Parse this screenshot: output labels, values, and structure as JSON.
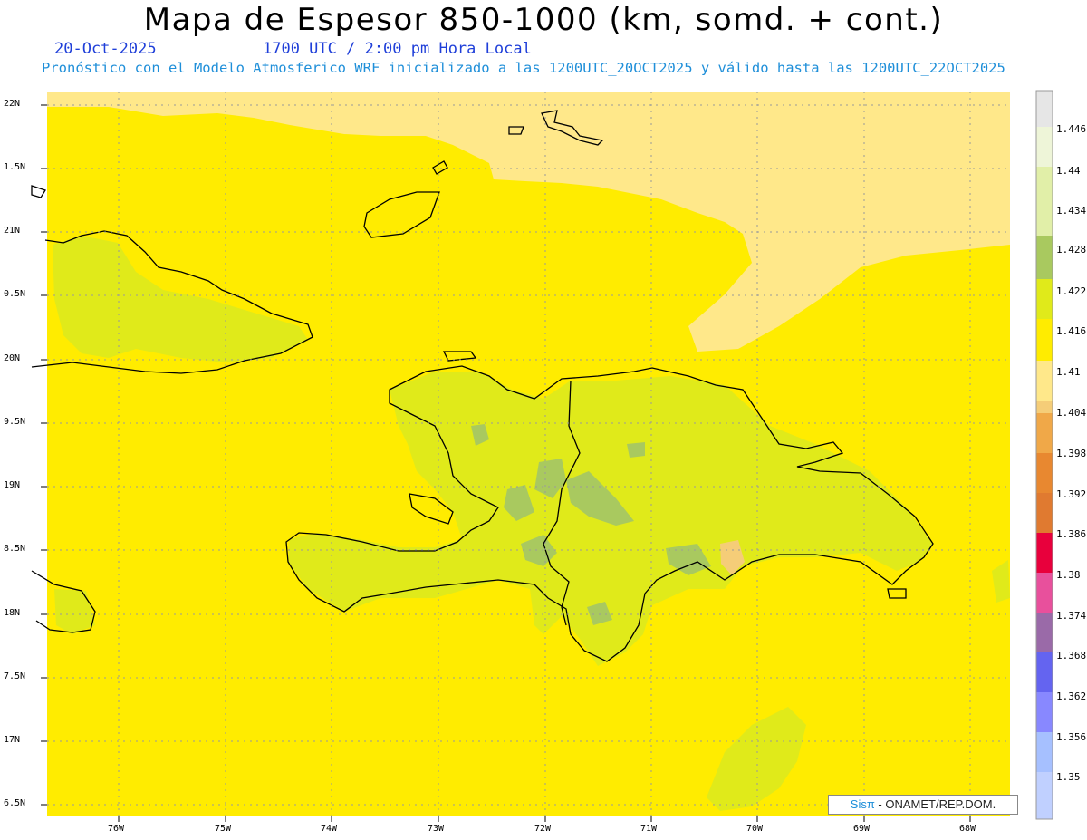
{
  "header": {
    "title": "Mapa de Espesor 850-1000 (km, somd. + cont.)",
    "date": "20-Oct-2025",
    "time": "1700 UTC / 2:00 pm Hora Local",
    "forecast": "Pronóstico con el Modelo Atmosferico WRF inicializado a las 1200UTC_20OCT2025 y válido hasta las  1200UTC_22OCT2025"
  },
  "map": {
    "lat_labels": [
      "22N",
      "1.5N",
      "21N",
      "0.5N",
      "20N",
      "9.5N",
      "19N",
      "8.5N",
      "18N",
      "7.5N",
      "17N",
      "6.5N"
    ],
    "lon_labels": [
      "76W",
      "75W",
      "74W",
      "73W",
      "72W",
      "71W",
      "70W",
      "69W",
      "68W"
    ],
    "features": [
      "Hispaniola",
      "Cuba (east)",
      "Great Inagua",
      "Turks and Caicos",
      "Caribbean Sea"
    ]
  },
  "colorbar": {
    "labels": [
      "1.446",
      "1.44",
      "1.434",
      "1.428",
      "1.422",
      "1.416",
      "1.41",
      "1.404",
      "1.398",
      "1.392",
      "1.386",
      "1.38",
      "1.374",
      "1.368",
      "1.362",
      "1.356",
      "1.35"
    ],
    "colors": [
      "#e6e6e6",
      "#eef5d8",
      "#e1efa8",
      "#a9c95f",
      "#e0ea1a",
      "#e9ee00",
      "#ffec00",
      "#ffe88a",
      "#f5cd78",
      "#f0a848",
      "#e88830",
      "#e07a30",
      "#e8003c",
      "#e8509c",
      "#9a6aa8",
      "#6464f0",
      "#8888ff",
      "#8ea8ff",
      "#a6c0ff",
      "#c0d0ff"
    ]
  },
  "credit": {
    "brand": "Sisπ",
    "text": " - ONAMET/REP.DOM."
  }
}
